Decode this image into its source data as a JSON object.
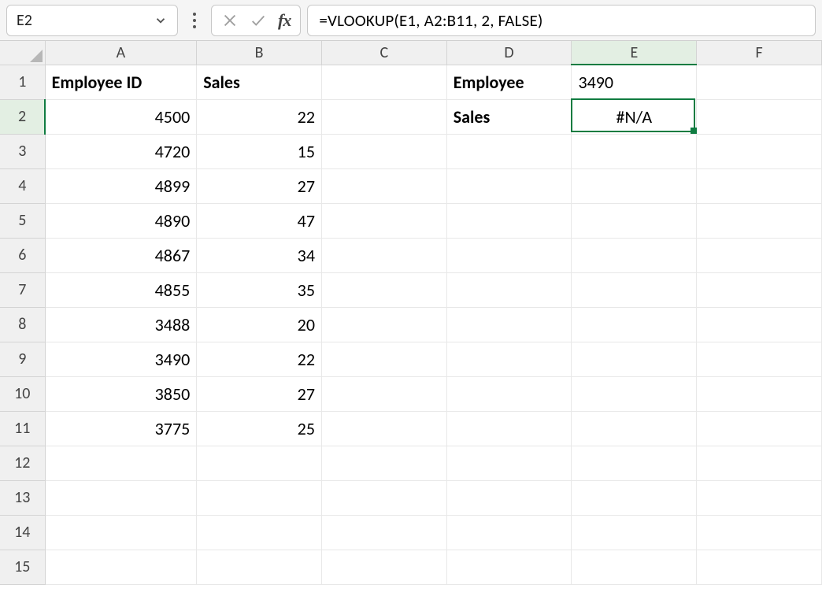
{
  "namebox": {
    "value": "E2"
  },
  "formula": "=VLOOKUP(E1, A2:B11, 2, FALSE)",
  "columns": [
    "A",
    "B",
    "C",
    "D",
    "E",
    "F"
  ],
  "rows": [
    1,
    2,
    3,
    4,
    5,
    6,
    7,
    8,
    9,
    10,
    11,
    12,
    13,
    14,
    15
  ],
  "active_cell": {
    "col": "E",
    "row": 2
  },
  "headers": {
    "A1": "Employee ID",
    "B1": "Sales",
    "D1": "Employee",
    "D2": "Sales"
  },
  "data": {
    "E1": "3490",
    "E2": "#N/A",
    "table": [
      {
        "id": "4500",
        "sales": "22"
      },
      {
        "id": "4720",
        "sales": "15"
      },
      {
        "id": "4899",
        "sales": "27"
      },
      {
        "id": "4890",
        "sales": "47"
      },
      {
        "id": "4867",
        "sales": "34"
      },
      {
        "id": "4855",
        "sales": "35"
      },
      {
        "id": "3488",
        "sales": "20"
      },
      {
        "id": "3490",
        "sales": "22"
      },
      {
        "id": "3850",
        "sales": "27"
      },
      {
        "id": "3775",
        "sales": "25"
      }
    ]
  },
  "icons": {
    "chevron_down": "chevron-down-icon",
    "kebab": "kebab-icon",
    "cancel": "cancel-icon",
    "accept": "accept-icon",
    "fx": "fx"
  },
  "colors": {
    "accent": "#107c41",
    "header_bg": "#f0f0f0",
    "grid_line": "#e8e8e8"
  }
}
